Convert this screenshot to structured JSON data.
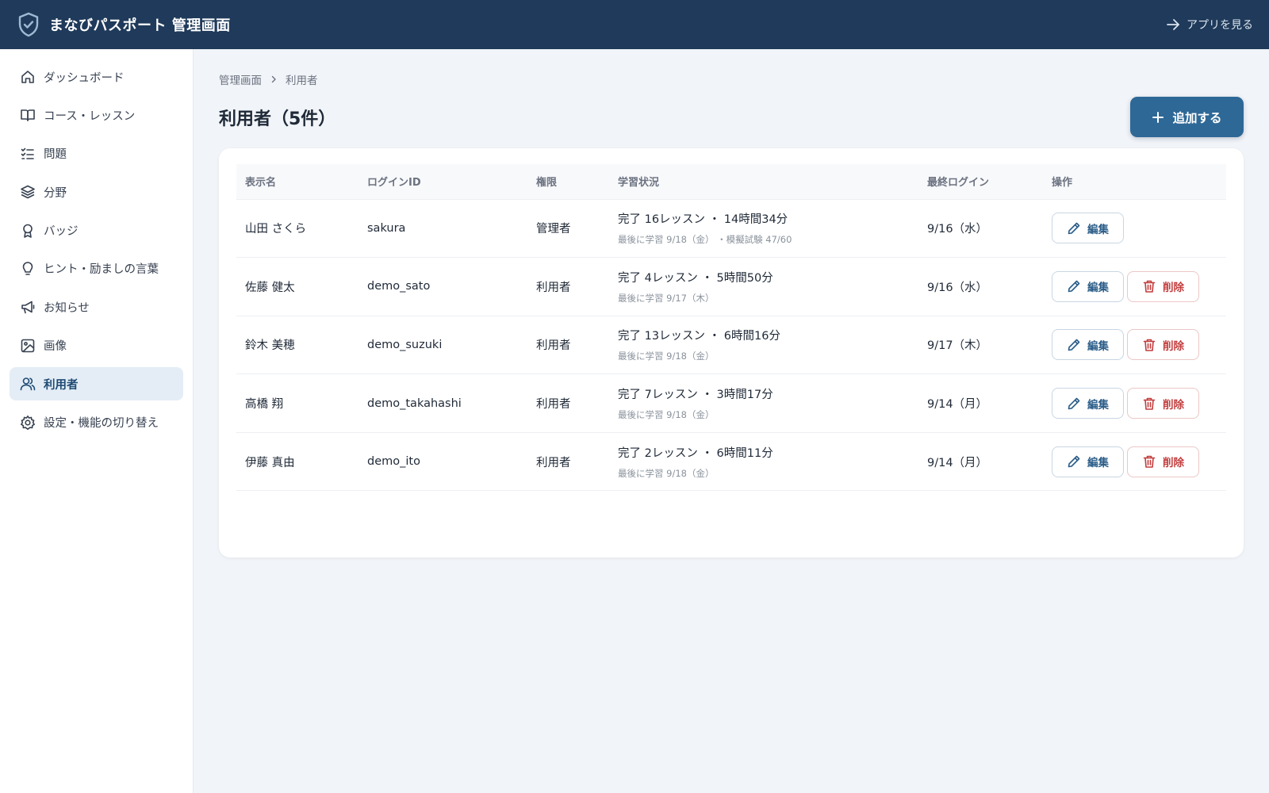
{
  "header": {
    "title": "まなびパスポート 管理画面",
    "app_link": "アプリを見る"
  },
  "sidebar": {
    "items": [
      {
        "label": "ダッシュボード",
        "icon": "home-icon",
        "active": false
      },
      {
        "label": "コース・レッスン",
        "icon": "book-icon",
        "active": false
      },
      {
        "label": "問題",
        "icon": "checklist-icon",
        "active": false
      },
      {
        "label": "分野",
        "icon": "layers-icon",
        "active": false
      },
      {
        "label": "バッジ",
        "icon": "badge-icon",
        "active": false
      },
      {
        "label": "ヒント・励ましの言葉",
        "icon": "lightbulb-icon",
        "active": false
      },
      {
        "label": "お知らせ",
        "icon": "megaphone-icon",
        "active": false
      },
      {
        "label": "画像",
        "icon": "image-icon",
        "active": false
      },
      {
        "label": "利用者",
        "icon": "users-icon",
        "active": true
      },
      {
        "label": "設定・機能の切り替え",
        "icon": "gear-icon",
        "active": false
      }
    ]
  },
  "breadcrumb": {
    "root": "管理画面",
    "current": "利用者"
  },
  "page": {
    "title": "利用者（5件）",
    "add_button": "追加する"
  },
  "table": {
    "columns": [
      "表示名",
      "ログインID",
      "権限",
      "学習状況",
      "最終ログイン",
      "操作"
    ],
    "rows": [
      {
        "name": "山田 さくら",
        "login_id": "sakura",
        "role": "管理者",
        "status_main": "完了 16レッスン ・ 14時間34分",
        "status_sub": "最後に学習 9/18（金） ・模擬試験 47/60",
        "last_login": "9/16（水）",
        "edit": "編集",
        "delete": null
      },
      {
        "name": "佐藤 健太",
        "login_id": "demo_sato",
        "role": "利用者",
        "status_main": "完了 4レッスン ・ 5時間50分",
        "status_sub": "最後に学習 9/17（木）",
        "last_login": "9/16（水）",
        "edit": "編集",
        "delete": "削除"
      },
      {
        "name": "鈴木 美穂",
        "login_id": "demo_suzuki",
        "role": "利用者",
        "status_main": "完了 13レッスン ・ 6時間16分",
        "status_sub": "最後に学習 9/18（金）",
        "last_login": "9/17（木）",
        "edit": "編集",
        "delete": "削除"
      },
      {
        "name": "高橋 翔",
        "login_id": "demo_takahashi",
        "role": "利用者",
        "status_main": "完了 7レッスン ・ 3時間17分",
        "status_sub": "最後に学習 9/18（金）",
        "last_login": "9/14（月）",
        "edit": "編集",
        "delete": "削除"
      },
      {
        "name": "伊藤 真由",
        "login_id": "demo_ito",
        "role": "利用者",
        "status_main": "完了 2レッスン ・ 6時間11分",
        "status_sub": "最後に学習 9/18（金）",
        "last_login": "9/14（月）",
        "edit": "編集",
        "delete": "削除"
      }
    ]
  },
  "colors": {
    "header_bg": "#1f3a5a",
    "accent": "#2e6896",
    "active_nav_bg": "#e4edf6",
    "danger": "#c33d3d"
  }
}
